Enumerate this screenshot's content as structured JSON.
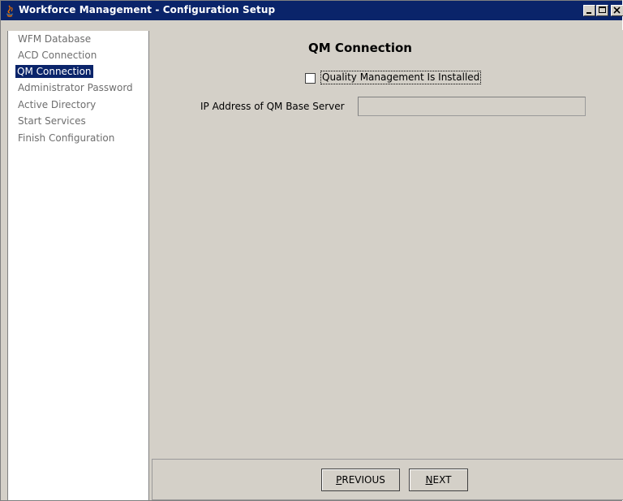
{
  "window": {
    "title": "Workforce Management - Configuration Setup"
  },
  "sidebar": {
    "items": [
      {
        "label": "WFM Database"
      },
      {
        "label": "ACD Connection"
      },
      {
        "label": "QM Connection",
        "selected": true
      },
      {
        "label": "Administrator Password"
      },
      {
        "label": "Active Directory"
      },
      {
        "label": "Start Services"
      },
      {
        "label": "Finish Configuration"
      }
    ]
  },
  "panel": {
    "title": "QM Connection",
    "checkbox_label": "Quality Management Is Installed",
    "checkbox_checked": false,
    "ip_label": "IP Address of QM Base Server",
    "ip_value": ""
  },
  "footer": {
    "previous_mnemonic": "P",
    "previous_rest": "REVIOUS",
    "next_mnemonic": "N",
    "next_rest": "EXT"
  },
  "colors": {
    "title_bar": "#0a246a",
    "selection": "#0a246a",
    "panel_bg": "#d4d0c8"
  }
}
